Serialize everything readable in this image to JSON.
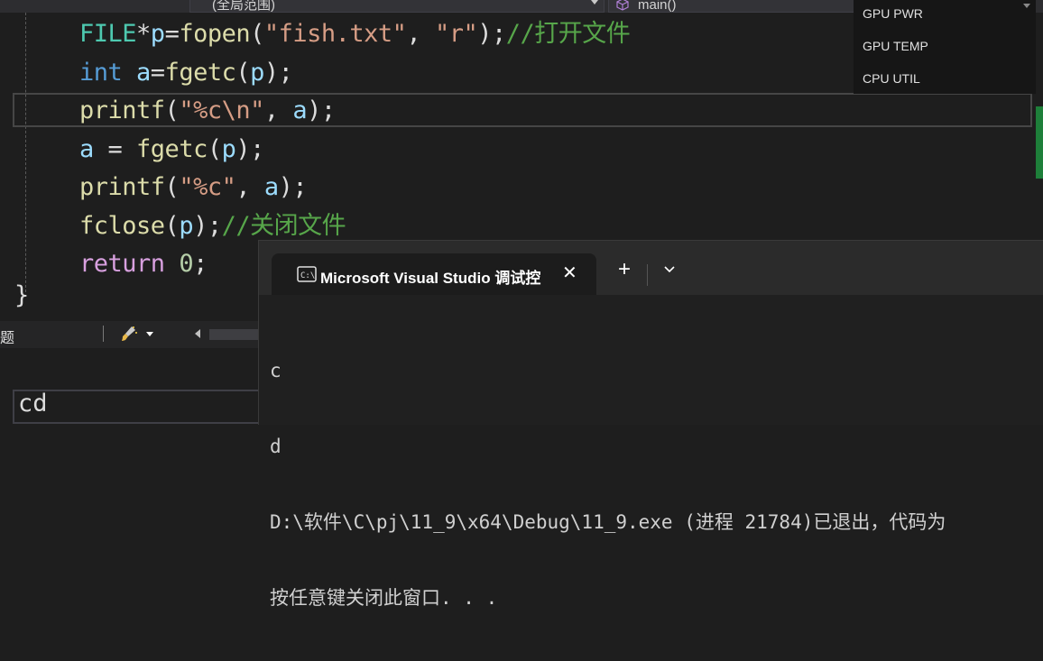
{
  "toolbar": {
    "scope_label": "(全局范围)",
    "function_label": "main()"
  },
  "code": {
    "lines": [
      {
        "segments": [
          {
            "t": "FILE",
            "c": "type"
          },
          {
            "t": "*",
            "c": "plain"
          },
          {
            "t": "p",
            "c": "var"
          },
          {
            "t": "=",
            "c": "plain"
          },
          {
            "t": "fopen",
            "c": "fn"
          },
          {
            "t": "(",
            "c": "plain"
          },
          {
            "t": "\"fish.txt\"",
            "c": "str"
          },
          {
            "t": ", ",
            "c": "plain"
          },
          {
            "t": "\"r\"",
            "c": "str"
          },
          {
            "t": ");",
            "c": "plain"
          },
          {
            "t": "//打开文件",
            "c": "cmt"
          }
        ]
      },
      {
        "segments": [
          {
            "t": "int",
            "c": "kw"
          },
          {
            "t": " a",
            "c": "var"
          },
          {
            "t": "=",
            "c": "plain"
          },
          {
            "t": "fgetc",
            "c": "fn"
          },
          {
            "t": "(",
            "c": "plain"
          },
          {
            "t": "p",
            "c": "var"
          },
          {
            "t": ");",
            "c": "plain"
          }
        ]
      },
      {
        "segments": [
          {
            "t": "printf",
            "c": "fn"
          },
          {
            "t": "(",
            "c": "plain"
          },
          {
            "t": "\"%c\\n\"",
            "c": "str"
          },
          {
            "t": ", ",
            "c": "plain"
          },
          {
            "t": "a",
            "c": "var"
          },
          {
            "t": ");",
            "c": "plain"
          }
        ]
      },
      {
        "segments": [
          {
            "t": "a",
            "c": "var"
          },
          {
            "t": " = ",
            "c": "plain"
          },
          {
            "t": "fgetc",
            "c": "fn"
          },
          {
            "t": "(",
            "c": "plain"
          },
          {
            "t": "p",
            "c": "var"
          },
          {
            "t": ");",
            "c": "plain"
          }
        ]
      },
      {
        "segments": [
          {
            "t": "printf",
            "c": "fn"
          },
          {
            "t": "(",
            "c": "plain"
          },
          {
            "t": "\"%c\"",
            "c": "str"
          },
          {
            "t": ", ",
            "c": "plain"
          },
          {
            "t": "a",
            "c": "var"
          },
          {
            "t": ");",
            "c": "plain"
          }
        ]
      },
      {
        "segments": [
          {
            "t": "fclose",
            "c": "fn"
          },
          {
            "t": "(",
            "c": "plain"
          },
          {
            "t": "p",
            "c": "var"
          },
          {
            "t": ");",
            "c": "plain"
          },
          {
            "t": "//关闭文件",
            "c": "cmt"
          }
        ]
      },
      {
        "segments": [
          {
            "t": "return",
            "c": "ret"
          },
          {
            "t": " ",
            "c": "plain"
          },
          {
            "t": "0",
            "c": "num"
          },
          {
            "t": ";",
            "c": "plain"
          }
        ]
      }
    ],
    "closing_brace": "}"
  },
  "perf_overlay": {
    "rows": [
      "GPU PWR",
      "GPU TEMP",
      "CPU UTIL"
    ]
  },
  "panel": {
    "label": "题",
    "output_value": "cd"
  },
  "terminal": {
    "tab_title": "Microsoft Visual Studio 调试控",
    "new_tab": "+",
    "lines": [
      "c",
      "d",
      "D:\\软件\\C\\pj\\11_9\\x64\\Debug\\11_9.exe (进程 21784)已退出，代码为",
      "按任意键关闭此窗口. . ."
    ]
  },
  "colors": {
    "editor_bg": "#1e1e1e",
    "type": "#4ec9b0",
    "keyword": "#569cd6",
    "variable": "#9cdcfe",
    "function": "#dcdcaa",
    "string": "#d69d85",
    "comment": "#57a64a",
    "return_kw": "#d8a0df",
    "number": "#b5cea8"
  },
  "icons": [
    "cube-icon",
    "brush-icon",
    "cmd-icon",
    "close-icon",
    "chevron-down-icon"
  ]
}
